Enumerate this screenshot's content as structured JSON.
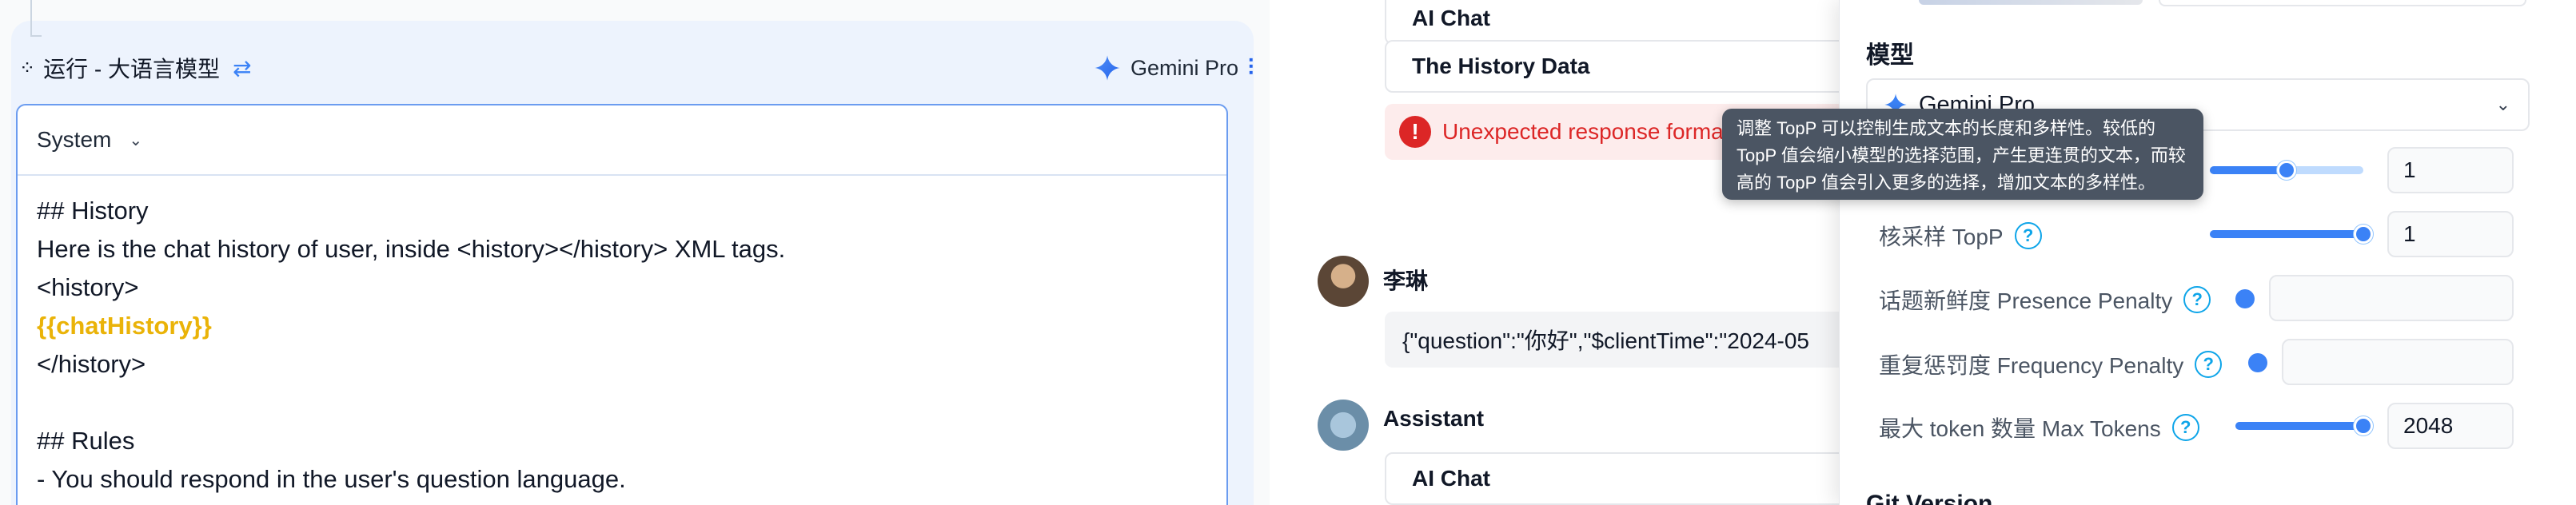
{
  "run_panel": {
    "title": "运行 - 大语言模型",
    "model_label": "Gemini Pro",
    "role_select": "System",
    "prompt_lines": [
      "## History",
      "Here is the chat history of user, inside <history></history> XML tags.",
      "<history>",
      "{{chatHistory}}",
      "</history>",
      "",
      "## Rules",
      "- You should respond in the user's question language."
    ]
  },
  "chat": {
    "card_ai_chat_top": "AI Chat",
    "card_history_data": "The History Data",
    "error_text": "Unexpected response format",
    "user_name": "李琳",
    "user_message": "{\"question\":\"你好\",\"$clientTime\":\"2024-05",
    "assistant_name": "Assistant",
    "card_ai_chat_bottom": "AI Chat"
  },
  "settings": {
    "model_heading": "模型",
    "model_selected": "Gemini Pro",
    "params": [
      {
        "label": "",
        "value": "1",
        "level": 0.6
      },
      {
        "label": "核采样 TopP",
        "value": "1",
        "level": 1.0
      },
      {
        "label": "话题新鲜度 Presence Penalty",
        "value": "",
        "level": 0.0
      },
      {
        "label": "重复惩罚度 Frequency Penalty",
        "value": "",
        "level": 0.0
      },
      {
        "label": "最大 token 数量 Max Tokens",
        "value": "2048",
        "level": 1.0
      }
    ],
    "section_cut_label": "Git Version"
  },
  "tooltip": {
    "lines": [
      "调整 TopP 可以控制生成文本的长度和多样性。较低的",
      "TopP 值会缩小模型的选择范围，产生更连贯的文本，而较",
      "高的 TopP 值会引入更多的选择，增加文本的多样性。"
    ]
  },
  "colors": {
    "accent": "#3b82f6",
    "error": "#dc2626",
    "variable": "#eab308",
    "tooltip_bg": "#4b5563"
  }
}
